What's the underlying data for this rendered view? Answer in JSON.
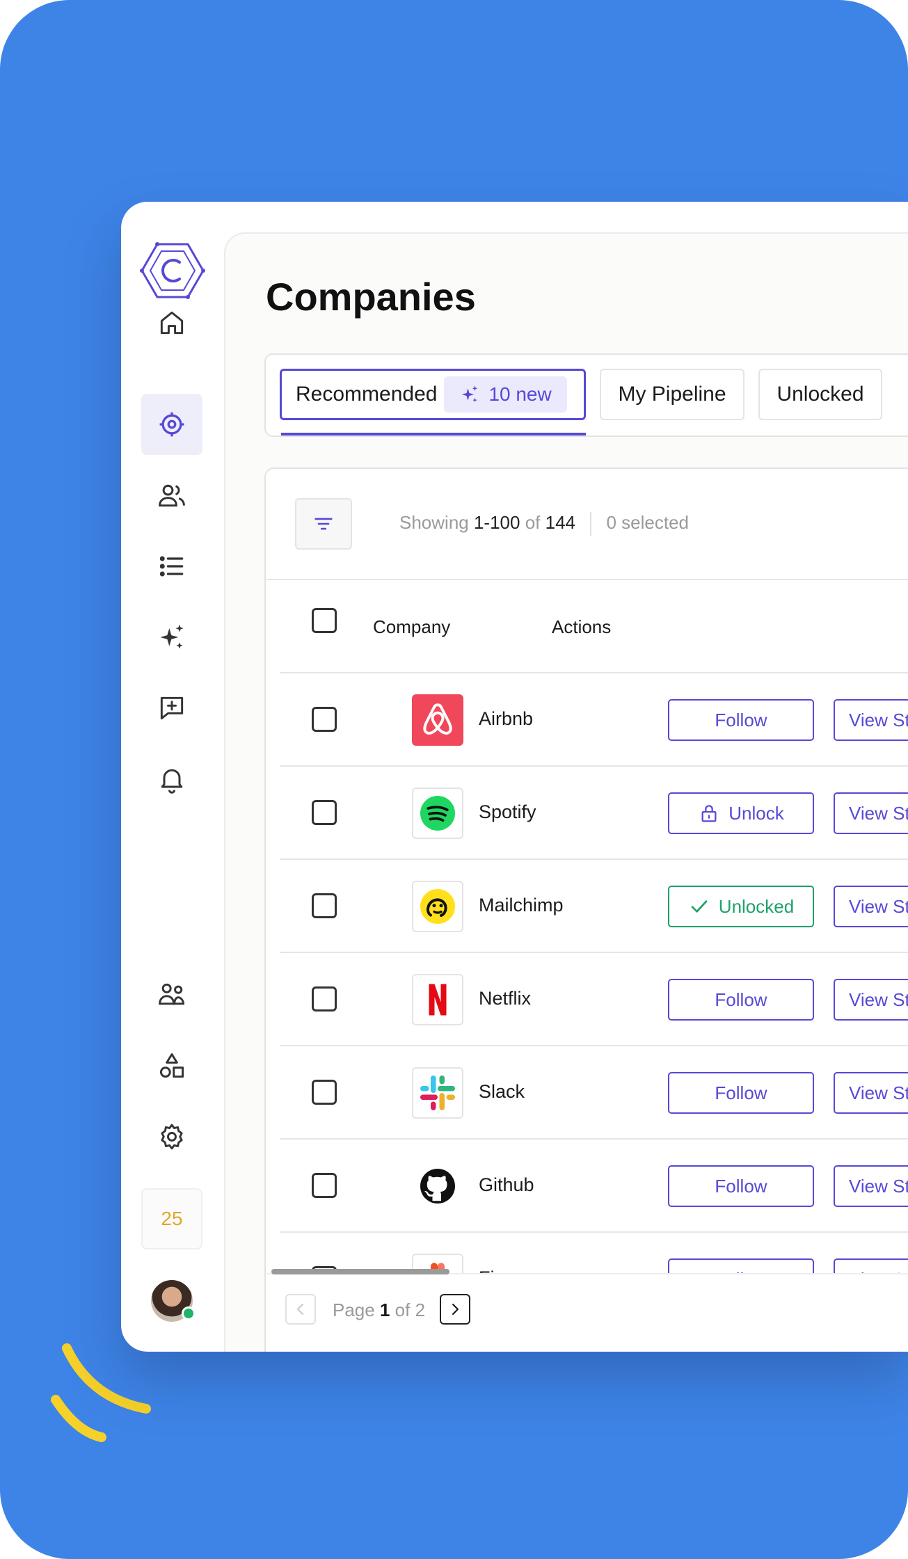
{
  "page": {
    "title": "Companies"
  },
  "tabs": [
    {
      "label": "Recommended",
      "badge": "10 new"
    },
    {
      "label": "My Pipeline"
    },
    {
      "label": "Unlocked"
    }
  ],
  "toolbar": {
    "showing_prefix": "Showing",
    "range": "1-100",
    "of_word": "of",
    "total": "144",
    "selected": "0 selected"
  },
  "table": {
    "headers": {
      "company": "Company",
      "actions": "Actions"
    },
    "rows": [
      {
        "company": "Airbnb",
        "action": "Follow",
        "view": "View Sta"
      },
      {
        "company": "Spotify",
        "action": "Unlock",
        "view": "View Sta"
      },
      {
        "company": "Mailchimp",
        "action": "Unlocked",
        "view": "View Sta"
      },
      {
        "company": "Netflix",
        "action": "Follow",
        "view": "View Sta"
      },
      {
        "company": "Slack",
        "action": "Follow",
        "view": "View Sta"
      },
      {
        "company": "Github",
        "action": "Follow",
        "view": "View Sta"
      },
      {
        "company": "Figma",
        "action": "Follow",
        "view": "View Sta"
      }
    ]
  },
  "pagination": {
    "page_word": "Page",
    "current": "1",
    "of_word": "of",
    "total": "2"
  },
  "sidebar": {
    "credits": "25"
  },
  "colors": {
    "accent": "#5649d6",
    "background": "#3e84e6",
    "success": "#1fa06a",
    "credits": "#e3a52a"
  }
}
